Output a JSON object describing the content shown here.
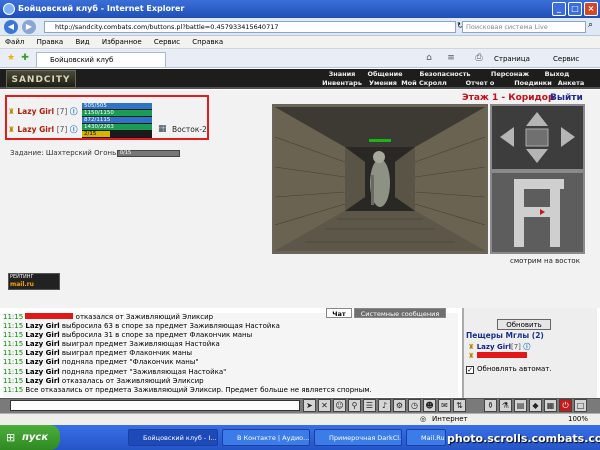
{
  "window": {
    "title": "Бойцовский клуб - Internet Explorer"
  },
  "address": {
    "url": "http://sandcity.combats.com/buttons.pl?battle=0.457933415640717",
    "search_placeholder": "Поисковая система Live"
  },
  "menu": [
    "Файл",
    "Правка",
    "Вид",
    "Избранное",
    "Сервис",
    "Справка"
  ],
  "tab": {
    "label": "Бойцовский клуб"
  },
  "toolbar": {
    "page": "Страница",
    "tools": "Сервис"
  },
  "game": {
    "logo": "SANDCITY",
    "nav_top": [
      "Знания",
      "Общение",
      "Безопасность",
      "Персонаж",
      "Выход"
    ],
    "nav_bottom": [
      "Инвентарь",
      "Умения",
      "Мой Скролл",
      "Отчет о переводах",
      "Поединки",
      "Анкета"
    ],
    "players": [
      {
        "name": "Lazy Girl",
        "level": "[7]",
        "bars": [
          "505/505",
          "1150/1150",
          "872/1115",
          "1430/2263",
          "2/15"
        ]
      },
      {
        "name": "Lazy Girl",
        "level": "[7]",
        "bars": [
          "",
          "",
          "",
          "",
          ""
        ]
      }
    ],
    "ally_label": "Восток-2",
    "quest": {
      "label": "Задание: Шахтерский Огонь",
      "progress": "0/15"
    },
    "floor": "Этаж 1 - Коридор",
    "exit": "Выйти",
    "view_hint": "смотрим на восток",
    "counter_lines": [
      "РЕЙТИНГ",
      "mail.ru"
    ]
  },
  "chat": {
    "tabs": [
      "Чат",
      "Системные сообщения"
    ],
    "lines": [
      {
        "time": "11:15",
        "name": "",
        "text": "отказался от Заживляющий Эликсир"
      },
      {
        "time": "11:15",
        "name": "Lazy Girl",
        "text": "выбросила 63 в споре за предмет Заживляющая Настойка"
      },
      {
        "time": "11:15",
        "name": "Lazy Girl",
        "text": "выбросила 31 в споре за предмет Флакончик маны"
      },
      {
        "time": "11:15",
        "name": "Lazy Girl",
        "text": "выиграл предмет Заживляющая Настойка"
      },
      {
        "time": "11:15",
        "name": "Lazy Girl",
        "text": "выиграл предмет Флакончик маны"
      },
      {
        "time": "11:15",
        "name": "Lazy Girl",
        "text": "подняла предмет \"Флакончик маны\""
      },
      {
        "time": "11:15",
        "name": "Lazy Girl",
        "text": "подняла предмет \"Заживляющая Настойка\""
      },
      {
        "time": "11:15",
        "name": "Lazy Girl",
        "text": "отказалась от Заживляющий Эликсир"
      },
      {
        "time": "11:15",
        "name": "",
        "text": "Все отказались от предмета Заживляющий Эликсир. Предмет больше не является спорным."
      }
    ]
  },
  "side": {
    "refresh_button": "Обновить",
    "caves_header": "Пещеры Мглы (2)",
    "member": {
      "name": "Lazy Girl",
      "level": "[7]"
    },
    "auto_update_label": "Обновлять автомат."
  },
  "statusbar": {
    "zone": "Интернет",
    "zoom": "100%"
  },
  "taskbar": {
    "start": "пуск",
    "tasks": [
      "Бойцовский клуб - I...",
      "В Контакте | Аудио...",
      "Примерочная DarkCl...",
      "Mail.Ru"
    ],
    "watermark": "photo.scrolls.combats.com"
  }
}
